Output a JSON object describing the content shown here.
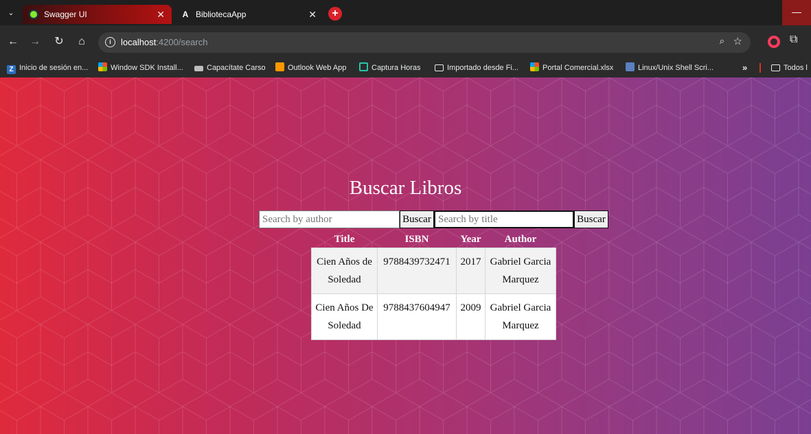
{
  "browser": {
    "tabs": [
      {
        "title": "Swagger UI",
        "active": true,
        "favicon": "swagger-icon"
      },
      {
        "title": "BibliotecaApp",
        "active": false,
        "favicon": "angular-icon"
      }
    ],
    "new_tab_symbol": "+",
    "url_host": "localhost",
    "url_path": ":4200/search",
    "bookmarks": [
      {
        "label": "Inicio de sesión en...",
        "icon": "zimbra-icon"
      },
      {
        "label": "Window SDK Install...",
        "icon": "microsoft-icon"
      },
      {
        "label": "Capacítate Carso",
        "icon": "cloud-icon"
      },
      {
        "label": "Outlook Web App",
        "icon": "outlook-icon"
      },
      {
        "label": "Captura Horas",
        "icon": "captura-icon"
      },
      {
        "label": "Importado desde Fi...",
        "icon": "folder-icon"
      },
      {
        "label": "Portal Comercial.xlsx",
        "icon": "microsoft-icon"
      },
      {
        "label": "Linux/Unix Shell Scri...",
        "icon": "document-icon"
      }
    ],
    "bookmarks_more": "»",
    "bookmarks_all": "Todos l"
  },
  "page": {
    "heading": "Buscar Libros",
    "author_search": {
      "placeholder": "Search by author",
      "button": "Buscar"
    },
    "title_search": {
      "placeholder": "Search by title",
      "button": "Buscar"
    },
    "table": {
      "headers": [
        "Title",
        "ISBN",
        "Year",
        "Author"
      ],
      "rows": [
        {
          "title": "Cien Años de Soledad",
          "isbn": "9788439732471",
          "year": "2017",
          "author": "Gabriel Garcia Marquez"
        },
        {
          "title": "Cien Años De Soledad",
          "isbn": "9788437604947",
          "year": "2009",
          "author": "Gabriel Garcia Marquez"
        }
      ]
    }
  },
  "colors": {
    "gradient_left": "#df2a3c",
    "gradient_right": "#7b3f91",
    "active_tab": "#b31212"
  }
}
